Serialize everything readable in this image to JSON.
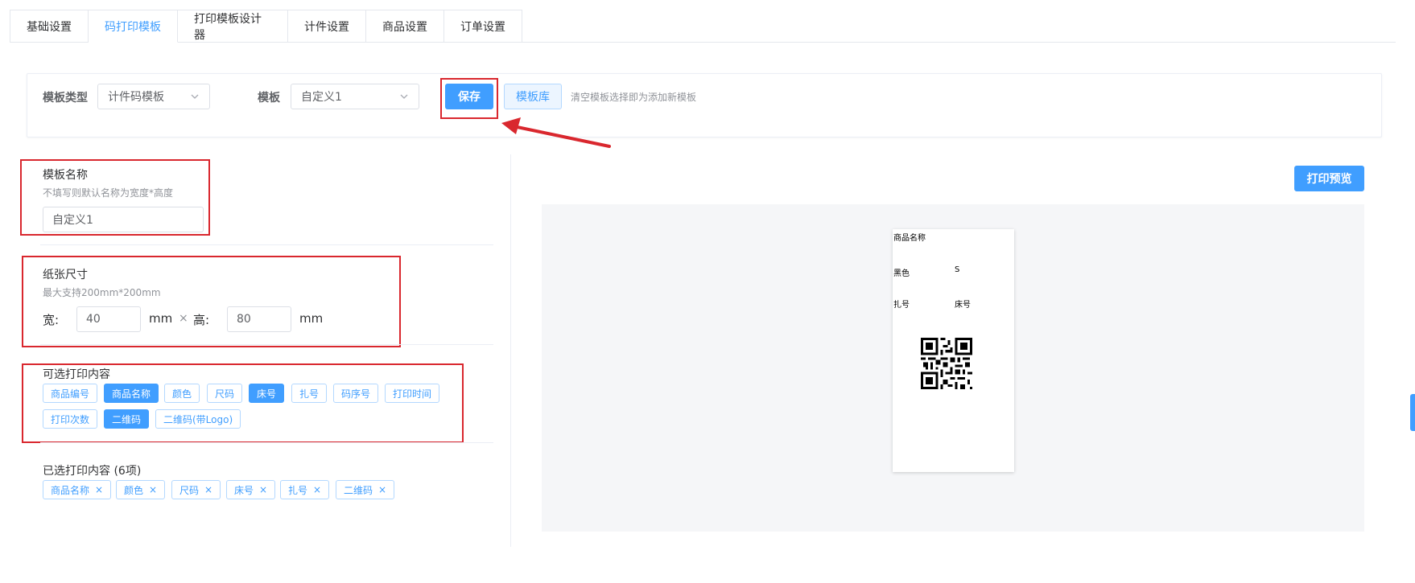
{
  "tabs": [
    {
      "label": "基础设置",
      "active": false
    },
    {
      "label": "码打印模板",
      "active": true
    },
    {
      "label": "打印模板设计器",
      "active": false
    },
    {
      "label": "计件设置",
      "active": false
    },
    {
      "label": "商品设置",
      "active": false
    },
    {
      "label": "订单设置",
      "active": false
    }
  ],
  "toolbar": {
    "template_type_label": "模板类型",
    "template_type_value": "计件码模板",
    "template_label": "模板",
    "template_value": "自定义1",
    "save_label": "保存",
    "library_label": "模板库",
    "hint": "清空模板选择即为添加新模板"
  },
  "form": {
    "name_title": "模板名称",
    "name_hint": "不填写则默认名称为宽度*高度",
    "name_value": "自定义1",
    "paper_title": "纸张尺寸",
    "paper_hint": "最大支持200mm*200mm",
    "width_label": "宽:",
    "width_value": "40",
    "height_label": "高:",
    "height_value": "80",
    "unit": "mm",
    "times": "×",
    "optional_title": "可选打印内容",
    "optional_items": [
      {
        "label": "商品编号",
        "selected": false
      },
      {
        "label": "商品名称",
        "selected": true
      },
      {
        "label": "颜色",
        "selected": false
      },
      {
        "label": "尺码",
        "selected": false
      },
      {
        "label": "床号",
        "selected": true
      },
      {
        "label": "扎号",
        "selected": false
      },
      {
        "label": "码序号",
        "selected": false
      },
      {
        "label": "打印时间",
        "selected": false
      },
      {
        "label": "打印次数",
        "selected": false
      },
      {
        "label": "二维码",
        "selected": true
      },
      {
        "label": "二维码(带Logo)",
        "selected": false
      }
    ],
    "selected_title": "已选打印内容 (6项)",
    "selected_items": [
      "商品名称",
      "颜色",
      "尺码",
      "床号",
      "扎号",
      "二维码"
    ],
    "remove_glyph": "×"
  },
  "preview": {
    "button_label": "打印预览",
    "product_name": "商品名称",
    "color": "黑色",
    "size": "S",
    "bundle": "扎号",
    "bed": "床号"
  },
  "colors": {
    "accent": "#409eff",
    "annotation_red": "#d9272e"
  }
}
